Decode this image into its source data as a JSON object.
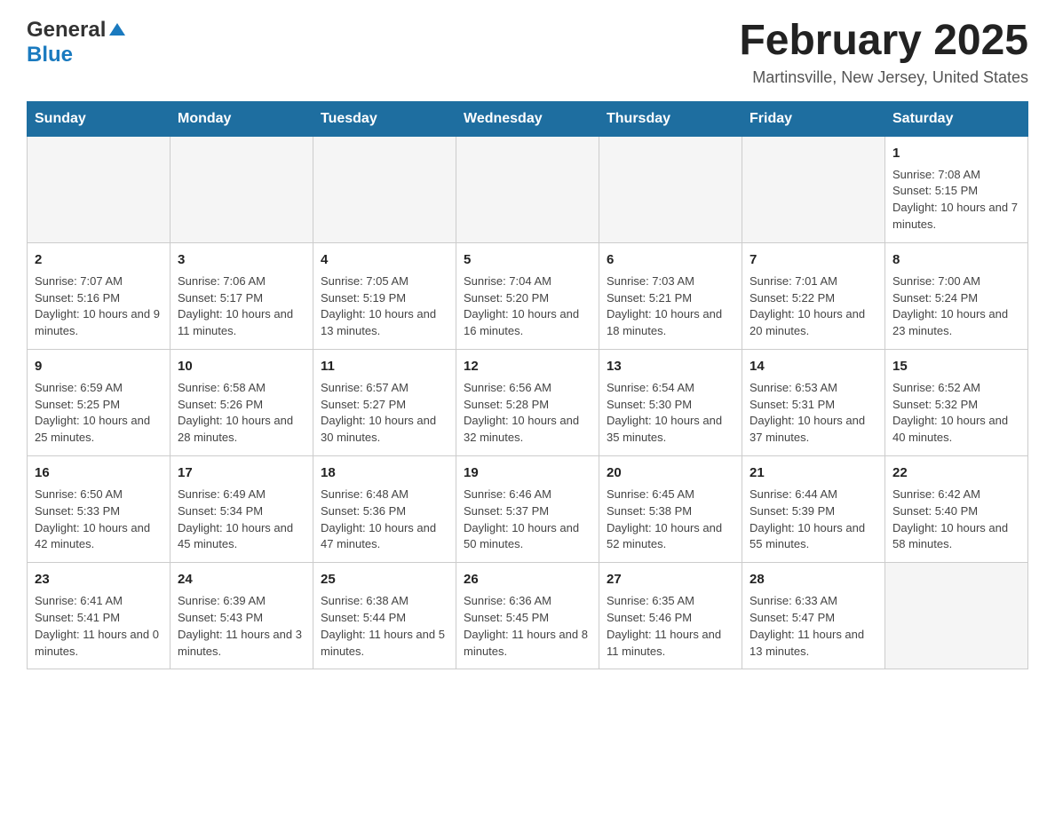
{
  "header": {
    "logo_general": "General",
    "logo_blue": "Blue",
    "title": "February 2025",
    "subtitle": "Martinsville, New Jersey, United States"
  },
  "days_of_week": [
    "Sunday",
    "Monday",
    "Tuesday",
    "Wednesday",
    "Thursday",
    "Friday",
    "Saturday"
  ],
  "weeks": [
    [
      {
        "day": "",
        "empty": true
      },
      {
        "day": "",
        "empty": true
      },
      {
        "day": "",
        "empty": true
      },
      {
        "day": "",
        "empty": true
      },
      {
        "day": "",
        "empty": true
      },
      {
        "day": "",
        "empty": true
      },
      {
        "day": "1",
        "sunrise": "7:08 AM",
        "sunset": "5:15 PM",
        "daylight": "10 hours and 7 minutes."
      }
    ],
    [
      {
        "day": "2",
        "sunrise": "7:07 AM",
        "sunset": "5:16 PM",
        "daylight": "10 hours and 9 minutes."
      },
      {
        "day": "3",
        "sunrise": "7:06 AM",
        "sunset": "5:17 PM",
        "daylight": "10 hours and 11 minutes."
      },
      {
        "day": "4",
        "sunrise": "7:05 AM",
        "sunset": "5:19 PM",
        "daylight": "10 hours and 13 minutes."
      },
      {
        "day": "5",
        "sunrise": "7:04 AM",
        "sunset": "5:20 PM",
        "daylight": "10 hours and 16 minutes."
      },
      {
        "day": "6",
        "sunrise": "7:03 AM",
        "sunset": "5:21 PM",
        "daylight": "10 hours and 18 minutes."
      },
      {
        "day": "7",
        "sunrise": "7:01 AM",
        "sunset": "5:22 PM",
        "daylight": "10 hours and 20 minutes."
      },
      {
        "day": "8",
        "sunrise": "7:00 AM",
        "sunset": "5:24 PM",
        "daylight": "10 hours and 23 minutes."
      }
    ],
    [
      {
        "day": "9",
        "sunrise": "6:59 AM",
        "sunset": "5:25 PM",
        "daylight": "10 hours and 25 minutes."
      },
      {
        "day": "10",
        "sunrise": "6:58 AM",
        "sunset": "5:26 PM",
        "daylight": "10 hours and 28 minutes."
      },
      {
        "day": "11",
        "sunrise": "6:57 AM",
        "sunset": "5:27 PM",
        "daylight": "10 hours and 30 minutes."
      },
      {
        "day": "12",
        "sunrise": "6:56 AM",
        "sunset": "5:28 PM",
        "daylight": "10 hours and 32 minutes."
      },
      {
        "day": "13",
        "sunrise": "6:54 AM",
        "sunset": "5:30 PM",
        "daylight": "10 hours and 35 minutes."
      },
      {
        "day": "14",
        "sunrise": "6:53 AM",
        "sunset": "5:31 PM",
        "daylight": "10 hours and 37 minutes."
      },
      {
        "day": "15",
        "sunrise": "6:52 AM",
        "sunset": "5:32 PM",
        "daylight": "10 hours and 40 minutes."
      }
    ],
    [
      {
        "day": "16",
        "sunrise": "6:50 AM",
        "sunset": "5:33 PM",
        "daylight": "10 hours and 42 minutes."
      },
      {
        "day": "17",
        "sunrise": "6:49 AM",
        "sunset": "5:34 PM",
        "daylight": "10 hours and 45 minutes."
      },
      {
        "day": "18",
        "sunrise": "6:48 AM",
        "sunset": "5:36 PM",
        "daylight": "10 hours and 47 minutes."
      },
      {
        "day": "19",
        "sunrise": "6:46 AM",
        "sunset": "5:37 PM",
        "daylight": "10 hours and 50 minutes."
      },
      {
        "day": "20",
        "sunrise": "6:45 AM",
        "sunset": "5:38 PM",
        "daylight": "10 hours and 52 minutes."
      },
      {
        "day": "21",
        "sunrise": "6:44 AM",
        "sunset": "5:39 PM",
        "daylight": "10 hours and 55 minutes."
      },
      {
        "day": "22",
        "sunrise": "6:42 AM",
        "sunset": "5:40 PM",
        "daylight": "10 hours and 58 minutes."
      }
    ],
    [
      {
        "day": "23",
        "sunrise": "6:41 AM",
        "sunset": "5:41 PM",
        "daylight": "11 hours and 0 minutes."
      },
      {
        "day": "24",
        "sunrise": "6:39 AM",
        "sunset": "5:43 PM",
        "daylight": "11 hours and 3 minutes."
      },
      {
        "day": "25",
        "sunrise": "6:38 AM",
        "sunset": "5:44 PM",
        "daylight": "11 hours and 5 minutes."
      },
      {
        "day": "26",
        "sunrise": "6:36 AM",
        "sunset": "5:45 PM",
        "daylight": "11 hours and 8 minutes."
      },
      {
        "day": "27",
        "sunrise": "6:35 AM",
        "sunset": "5:46 PM",
        "daylight": "11 hours and 11 minutes."
      },
      {
        "day": "28",
        "sunrise": "6:33 AM",
        "sunset": "5:47 PM",
        "daylight": "11 hours and 13 minutes."
      },
      {
        "day": "",
        "empty": true
      }
    ]
  ]
}
